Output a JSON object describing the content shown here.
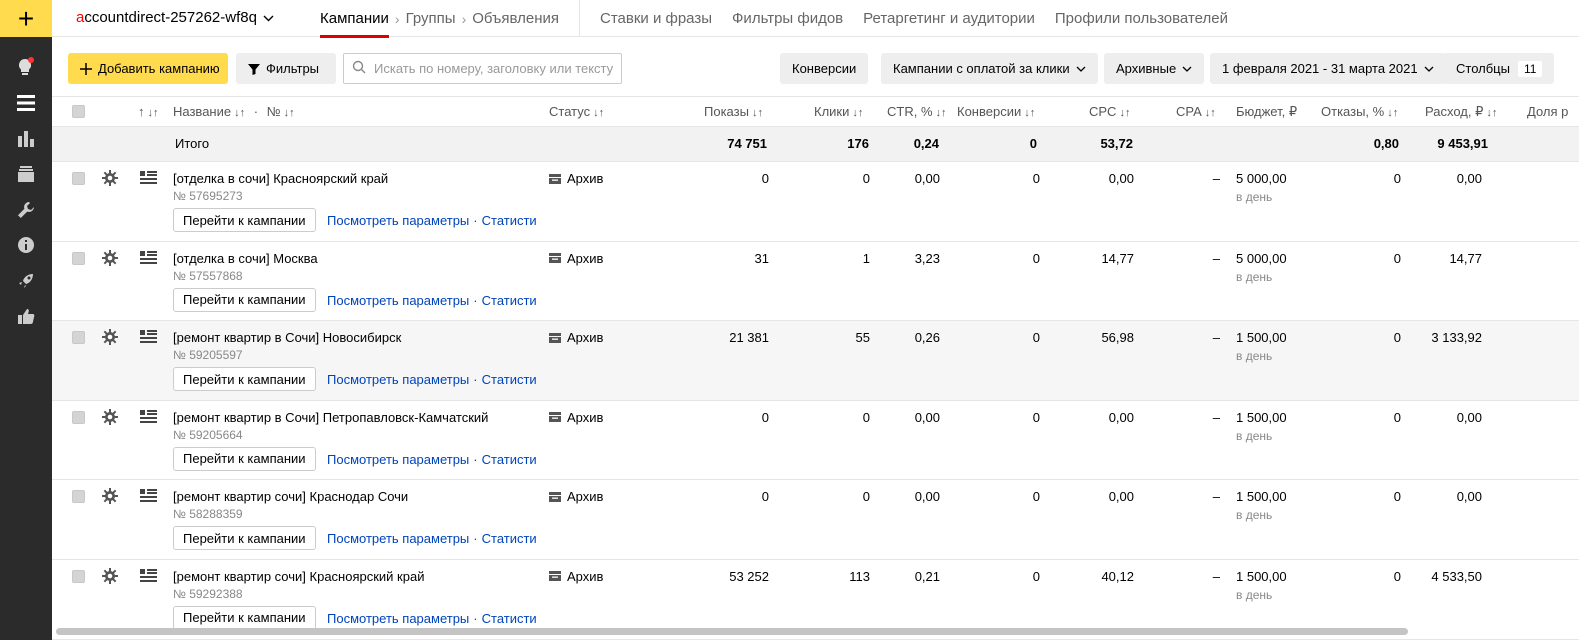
{
  "sidebar": {
    "add_label": "+"
  },
  "header": {
    "account_first": "a",
    "account_rest": "ccountdirect-257262-wf8q",
    "breadcrumb": [
      "Кампании",
      "Группы",
      "Объявления"
    ],
    "nav": [
      "Ставки и фразы",
      "Фильтры фидов",
      "Ретаргетинг и аудитории",
      "Профили пользователей"
    ]
  },
  "toolbar": {
    "add_campaign": "Добавить кампанию",
    "filters": "Фильтры",
    "search_placeholder": "Искать по номеру, заголовку или тексту",
    "conversions": "Конверсии",
    "campaign_type": "Кампании с оплатой за клики",
    "archived": "Архивные",
    "date_range": "1 февраля 2021 - 31 марта 2021",
    "columns": "Столбцы",
    "columns_count": "11"
  },
  "table": {
    "headers": {
      "flag": "↑",
      "name": "Название",
      "dot": "·",
      "no": "№",
      "status": "Статус",
      "shows": "Показы",
      "clicks": "Клики",
      "ctr": "CTR, %",
      "conv": "Конверсии",
      "cpc": "CPC",
      "cpa": "CPA",
      "budget": "Бюджет, ₽",
      "bounce": "Отказы, %",
      "spend": "Расход, ₽",
      "share": "Доля р"
    },
    "sort_arrows": "↓↑",
    "total": {
      "label": "Итого",
      "shows": "74 751",
      "clicks": "176",
      "ctr": "0,24",
      "conv": "0",
      "cpc": "53,72",
      "bounce": "0,80",
      "spend": "9 453,91"
    },
    "goto_label": "Перейти к кампании",
    "view_params": "Посмотреть параметры",
    "link_dot": "·",
    "stats": "Статистика",
    "per_day": "в день",
    "rows": [
      {
        "name": "[отделка в сочи] Красноярский край",
        "id": "№ 57695273",
        "status": "Архив",
        "shows": "0",
        "clicks": "0",
        "ctr": "0,00",
        "conv": "0",
        "cpc": "0,00",
        "cpa": "–",
        "budget": "5 000,00",
        "bounce": "0",
        "spend": "0,00"
      },
      {
        "name": "[отделка в сочи] Москва",
        "id": "№ 57557868",
        "status": "Архив",
        "shows": "31",
        "clicks": "1",
        "ctr": "3,23",
        "conv": "0",
        "cpc": "14,77",
        "cpa": "–",
        "budget": "5 000,00",
        "bounce": "0",
        "spend": "14,77"
      },
      {
        "name": "[ремонт квартир в Сочи] Новосибирск",
        "id": "№ 59205597",
        "status": "Архив",
        "shows": "21 381",
        "clicks": "55",
        "ctr": "0,26",
        "conv": "0",
        "cpc": "56,98",
        "cpa": "–",
        "budget": "1 500,00",
        "bounce": "0",
        "spend": "3 133,92"
      },
      {
        "name": "[ремонт квартир в Сочи] Петропавловск-Камчатский",
        "id": "№ 59205664",
        "status": "Архив",
        "shows": "0",
        "clicks": "0",
        "ctr": "0,00",
        "conv": "0",
        "cpc": "0,00",
        "cpa": "–",
        "budget": "1 500,00",
        "bounce": "0",
        "spend": "0,00"
      },
      {
        "name": "[ремонт квартир сочи] Краснодар Сочи",
        "id": "№ 58288359",
        "status": "Архив",
        "shows": "0",
        "clicks": "0",
        "ctr": "0,00",
        "conv": "0",
        "cpc": "0,00",
        "cpa": "–",
        "budget": "1 500,00",
        "bounce": "0",
        "spend": "0,00"
      },
      {
        "name": "[ремонт квартир сочи] Красноярский край",
        "id": "№ 59292388",
        "status": "Архив",
        "shows": "53 252",
        "clicks": "113",
        "ctr": "0,21",
        "conv": "0",
        "cpc": "40,12",
        "cpa": "–",
        "budget": "1 500,00",
        "bounce": "0",
        "spend": "4 533,50"
      }
    ]
  }
}
